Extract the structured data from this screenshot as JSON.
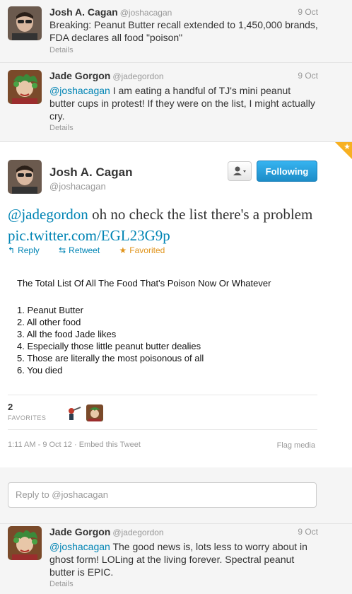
{
  "tweets_top": [
    {
      "name": "Josh A. Cagan",
      "handle": "@joshacagan",
      "time": "9 Oct",
      "text": "Breaking: Peanut Butter recall extended to 1,450,000 brands, FDA declares all food \"poison\"",
      "details": "Details"
    },
    {
      "name": "Jade Gorgon",
      "handle": "@jadegordon",
      "time": "9 Oct",
      "mention": "@joshacagan",
      "text": " I am eating a handful of TJ's mini peanut butter cups in protest! If they were on the list, I might actually cry.",
      "details": "Details"
    }
  ],
  "focus": {
    "name": "Josh A. Cagan",
    "handle": "@joshacagan",
    "follow_label": "Following",
    "mention": "@jadegordon",
    "text": " oh no check the list there's a problem ",
    "link": "pic.twitter.com/EGL23G9p",
    "actions": {
      "reply": "Reply",
      "retweet": "Retweet",
      "favorited": "Favorited"
    },
    "media": {
      "title": "The Total List Of All The Food That's Poison Now Or Whatever",
      "items": [
        "1. Peanut Butter",
        "2. All other food",
        "3. All the food Jade likes",
        "4. Especially those little peanut butter dealies",
        "5. Those are literally the most poisonous of all",
        "6. You died"
      ]
    },
    "favorites_count": "2",
    "favorites_label": "FAVORITES",
    "timestamp": "1:11 AM - 9 Oct 12",
    "embed": "Embed this Tweet",
    "flag": "Flag media"
  },
  "reply": {
    "placeholder": "Reply to @joshacagan"
  },
  "tweet_bottom": {
    "name": "Jade Gorgon",
    "handle": "@jadegordon",
    "time": "9 Oct",
    "mention": "@joshacagan",
    "text": " The good news is, lots less to worry about in ghost form! LOLing at the living forever. Spectral peanut butter is EPIC.",
    "details": "Details"
  },
  "colors": {
    "link": "#0084b4",
    "follow_button": "#2ba4e2",
    "favorite": "#e0931a"
  }
}
